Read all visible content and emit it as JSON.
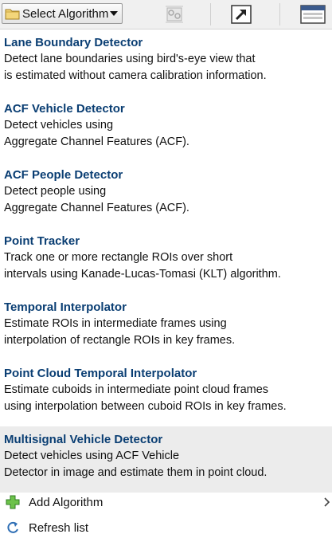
{
  "toolbar": {
    "algorithm_dropdown_label": "Select Algorithm"
  },
  "algorithms": [
    {
      "title": "Lane Boundary Detector",
      "line1": "Detect lane boundaries using bird's-eye view that",
      "line2": "is estimated without camera calibration information."
    },
    {
      "title": "ACF Vehicle Detector",
      "line1": "Detect vehicles using",
      "line2": "Aggregate Channel Features (ACF)."
    },
    {
      "title": "ACF People Detector",
      "line1": "Detect people using",
      "line2": "Aggregate Channel Features (ACF)."
    },
    {
      "title": "Point Tracker",
      "line1": "Track one or more rectangle ROIs over short",
      "line2": "intervals using Kanade-Lucas-Tomasi (KLT) algorithm."
    },
    {
      "title": "Temporal Interpolator",
      "line1": "Estimate ROIs in intermediate frames using",
      "line2": "interpolation of rectangle ROIs in key frames."
    },
    {
      "title": "Point Cloud Temporal Interpolator",
      "line1": "Estimate cuboids in intermediate point cloud frames",
      "line2": "using interpolation between cuboid ROIs in key frames."
    },
    {
      "title": "Multisignal Vehicle Detector",
      "line1": "Detect vehicles using ACF Vehicle",
      "line2": "Detector in image and estimate them in point cloud."
    }
  ],
  "menu": {
    "add_algorithm": "Add Algorithm",
    "refresh_list": "Refresh list"
  },
  "colors": {
    "title": "#0a3e73",
    "selected_bg": "#ececec",
    "add_icon": "#3aa63a",
    "refresh_icon": "#2f6fb5"
  }
}
